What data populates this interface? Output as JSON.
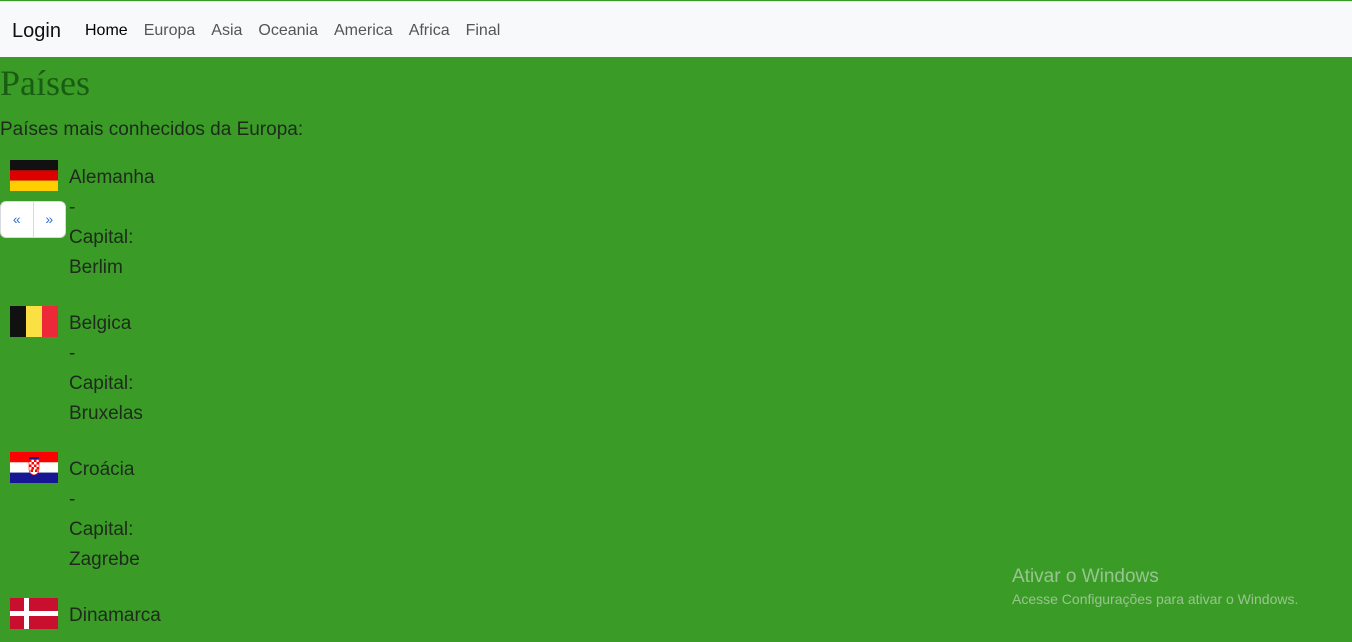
{
  "navbar": {
    "brand": "Login",
    "items": [
      {
        "label": "Home"
      },
      {
        "label": "Europa"
      },
      {
        "label": "Asia"
      },
      {
        "label": "Oceania"
      },
      {
        "label": "America"
      },
      {
        "label": "Africa"
      },
      {
        "label": "Final"
      }
    ]
  },
  "page": {
    "title": "Países",
    "subtitle": "Países mais conhecidos da Europa:"
  },
  "countries": [
    {
      "name": "Alemanha",
      "separator": "-",
      "capital_label": "Capital:",
      "capital": "Berlim",
      "flag": "germany-flag-icon"
    },
    {
      "name": "Belgica",
      "separator": "-",
      "capital_label": "Capital:",
      "capital": "Bruxelas",
      "flag": "belgium-flag-icon"
    },
    {
      "name": "Croácia",
      "separator": "-",
      "capital_label": "Capital:",
      "capital": "Zagrebe",
      "flag": "croatia-flag-icon"
    },
    {
      "name": "Dinamarca",
      "flag": "denmark-flag-icon"
    }
  ],
  "pager": {
    "prev": "«",
    "next": "»"
  },
  "watermark": {
    "title": "Ativar o Windows",
    "subtitle": "Acesse Configurações para ativar o Windows."
  },
  "colors": {
    "background": "#3a9c26",
    "title": "#195d12",
    "navbar": "#f8f9fa"
  }
}
